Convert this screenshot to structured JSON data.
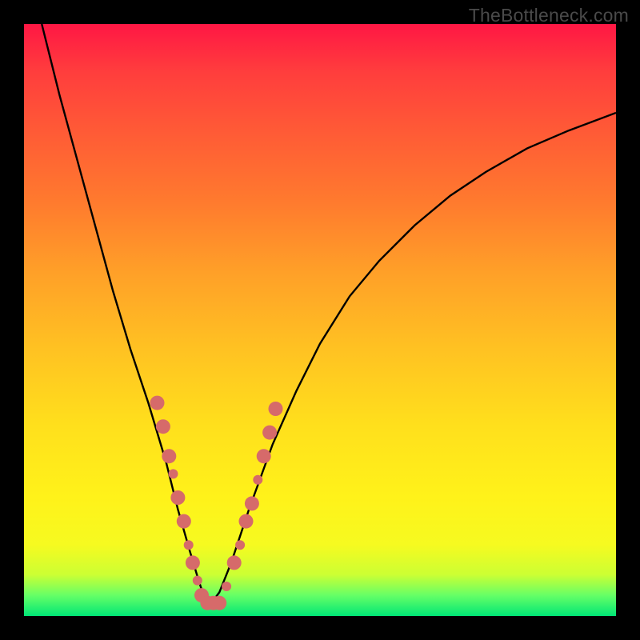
{
  "watermark": "TheBottleneck.com",
  "chart_data": {
    "type": "line",
    "title": "",
    "xlabel": "",
    "ylabel": "",
    "xlim": [
      0,
      100
    ],
    "ylim": [
      0,
      100
    ],
    "grid": false,
    "legend": false,
    "annotations": [],
    "series": [
      {
        "name": "curve",
        "stroke": "#000000",
        "x": [
          3,
          6,
          9,
          12,
          15,
          18,
          21,
          24,
          26,
          28,
          29.5,
          30.5,
          31.5,
          33,
          35,
          38,
          42,
          46,
          50,
          55,
          60,
          66,
          72,
          78,
          85,
          92,
          100
        ],
        "y": [
          100,
          88,
          77,
          66,
          55,
          45,
          36,
          26,
          18,
          11,
          6,
          3,
          2,
          4,
          9,
          18,
          29,
          38,
          46,
          54,
          60,
          66,
          71,
          75,
          79,
          82,
          85
        ]
      }
    ],
    "markers": {
      "name": "highlighted-points",
      "fill": "#d66a6a",
      "radius_large": 9,
      "radius_small": 6,
      "points": [
        {
          "x": 22.5,
          "y": 36,
          "r": 9
        },
        {
          "x": 23.5,
          "y": 32,
          "r": 9
        },
        {
          "x": 24.5,
          "y": 27,
          "r": 9
        },
        {
          "x": 25.2,
          "y": 24,
          "r": 6
        },
        {
          "x": 26.0,
          "y": 20,
          "r": 9
        },
        {
          "x": 27.0,
          "y": 16,
          "r": 9
        },
        {
          "x": 27.8,
          "y": 12,
          "r": 6
        },
        {
          "x": 28.5,
          "y": 9,
          "r": 9
        },
        {
          "x": 29.3,
          "y": 6,
          "r": 6
        },
        {
          "x": 30.0,
          "y": 3.5,
          "r": 9
        },
        {
          "x": 31.0,
          "y": 2.2,
          "r": 9
        },
        {
          "x": 32.0,
          "y": 2.2,
          "r": 9
        },
        {
          "x": 33.0,
          "y": 2.2,
          "r": 9
        },
        {
          "x": 34.2,
          "y": 5,
          "r": 6
        },
        {
          "x": 35.5,
          "y": 9,
          "r": 9
        },
        {
          "x": 36.5,
          "y": 12,
          "r": 6
        },
        {
          "x": 37.5,
          "y": 16,
          "r": 9
        },
        {
          "x": 38.5,
          "y": 19,
          "r": 9
        },
        {
          "x": 39.5,
          "y": 23,
          "r": 6
        },
        {
          "x": 40.5,
          "y": 27,
          "r": 9
        },
        {
          "x": 41.5,
          "y": 31,
          "r": 9
        },
        {
          "x": 42.5,
          "y": 35,
          "r": 9
        }
      ]
    }
  }
}
